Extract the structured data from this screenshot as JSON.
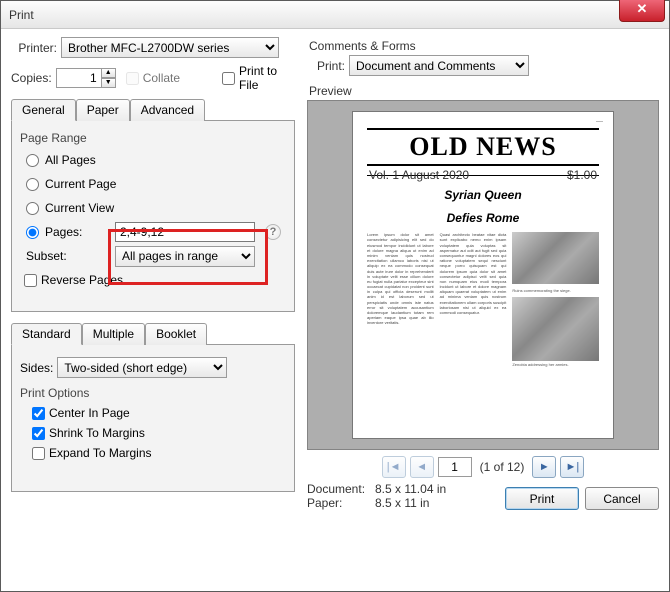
{
  "window": {
    "title": "Print"
  },
  "printer": {
    "label": "Printer:",
    "selected": "Brother MFC-L2700DW series",
    "copies_label": "Copies:",
    "copies_value": "1",
    "collate_label": "Collate",
    "print_to_file_label": "Print to File"
  },
  "comments": {
    "group": "Comments & Forms",
    "print_label": "Print:",
    "selected": "Document and Comments"
  },
  "tabs1": {
    "general": "General",
    "paper": "Paper",
    "advanced": "Advanced"
  },
  "page_range": {
    "group": "Page Range",
    "all": "All Pages",
    "current_page": "Current Page",
    "current_view": "Current View",
    "pages_label": "Pages:",
    "pages_value": "2,4-9,12",
    "subset_label": "Subset:",
    "subset_selected": "All pages in range",
    "reverse": "Reverse Pages"
  },
  "tabs2": {
    "standard": "Standard",
    "multiple": "Multiple",
    "booklet": "Booklet"
  },
  "sides": {
    "label": "Sides:",
    "selected": "Two-sided (short edge)"
  },
  "print_options": {
    "group": "Print Options",
    "center": "Center In Page",
    "shrink": "Shrink To Margins",
    "expand": "Expand To Margins"
  },
  "preview": {
    "group": "Preview",
    "masthead": "OLD NEWS",
    "dateline_left": "Vol. 1  August 2020",
    "dateline_right": "$1.00",
    "headline_l1": "Syrian Queen",
    "headline_l2": "Defies Rome",
    "page_field": "1",
    "page_count": "(1 of 12)",
    "doc_label": "Document:",
    "doc_value": "8.5 x 11.04 in",
    "paper_label": "Paper:",
    "paper_value": "8.5 x 11 in"
  },
  "buttons": {
    "print": "Print",
    "cancel": "Cancel"
  },
  "icons": {
    "help": "?"
  }
}
